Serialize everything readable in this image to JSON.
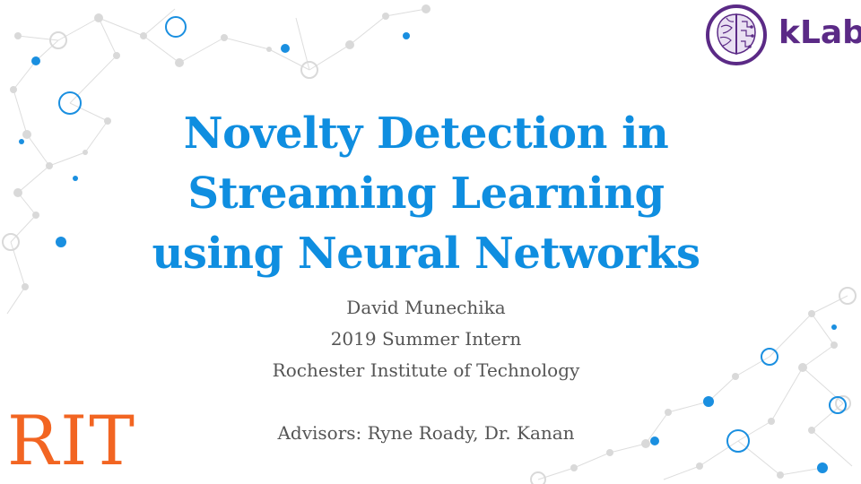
{
  "slide": {
    "title_lines": [
      "Novelty Detection in",
      "Streaming Learning",
      "using Neural Networks"
    ],
    "author": "David Munechika",
    "role": "2019 Summer Intern",
    "institution": "Rochester Institute of Technology",
    "advisors": "Advisors: Ryne Roady, Dr. Kanan"
  },
  "logos": {
    "rit": "RIT",
    "klab": "kLab",
    "klab_icon": "brain-icon"
  },
  "colors": {
    "title": "#0f8ee0",
    "body_text": "#555555",
    "rit_orange": "#f26522",
    "klab_purple": "#5b2a86",
    "network_grey": "#d9d9d9",
    "network_blue": "#1a8fe0"
  }
}
